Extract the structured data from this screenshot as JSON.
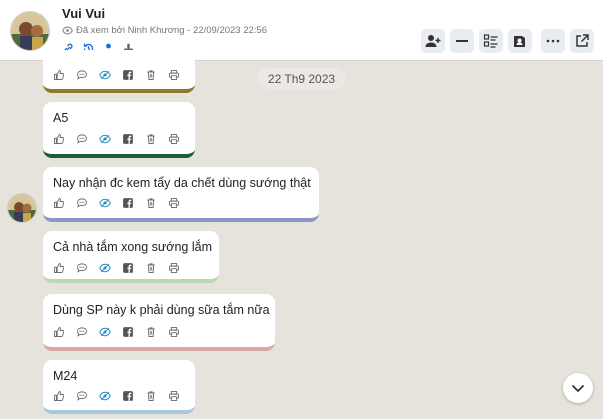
{
  "contact": {
    "name": "Vui Vui",
    "seen_status": "Đã xem bởi Ninh Khương - 22/09/2023 22:56"
  },
  "date_separator": "22 Th9 2023",
  "messages": [
    {
      "text": "",
      "accent": "#8a7a2a"
    },
    {
      "text": "A5",
      "accent": "#1f5a3a"
    },
    {
      "text": "Nay nhận đc kem tẩy da chết dùng sướng thật",
      "accent": "#8f95c9"
    },
    {
      "text": "Cả nhà tắm xong sướng lắm",
      "accent": "#b9d8b4"
    },
    {
      "text": "Dùng SP này k phải dùng sữa tắm nữa",
      "accent": "#d8a7a7"
    },
    {
      "text": "M24",
      "accent": "#a9c6de"
    }
  ],
  "colors": {
    "background": "#e6e2dc",
    "link_blue": "#1e6fd9",
    "icon_gray": "#6b6b6b"
  }
}
